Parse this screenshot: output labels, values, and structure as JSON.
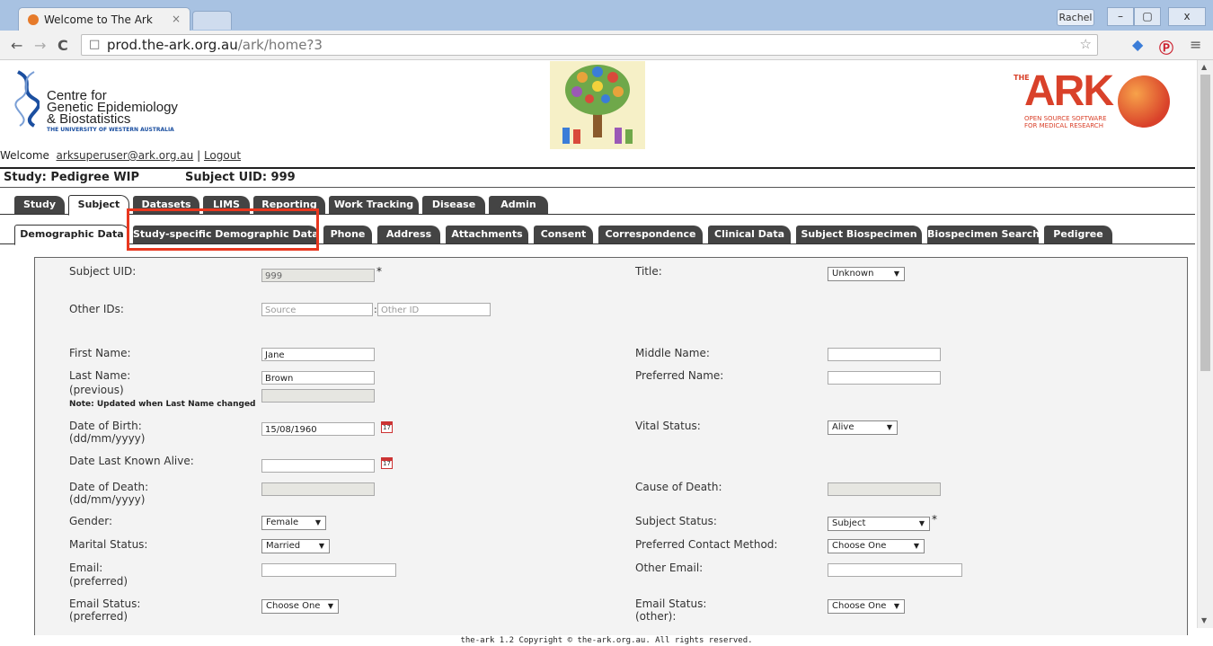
{
  "browser": {
    "tab_title": "Welcome to The Ark",
    "tab_close": "×",
    "user_badge": "Rachel",
    "win_min": "–",
    "win_max": "▢",
    "win_close": "x",
    "back": "←",
    "forward": "→",
    "reload": "C",
    "url_host": "prod.the-ark.org.au",
    "url_path": "/ark/home?3",
    "star": "☆",
    "menu": "≡"
  },
  "header": {
    "logo_line1": "Centre for",
    "logo_line2": "Genetic Epidemiology",
    "logo_line3": "& Biostatistics",
    "logo_sub": "THE UNIVERSITY OF WESTERN AUSTRALIA",
    "ark_the": "THE",
    "ark_word": "ARK",
    "ark_sub1": "OPEN SOURCE SOFTWARE",
    "ark_sub2": "FOR MEDICAL RESEARCH",
    "welcome": "Welcome",
    "user": "arksuperuser@ark.org.au",
    "separator": "|",
    "logout": "Logout"
  },
  "context": {
    "study": "Study: Pedigree WIP",
    "subject": "Subject UID: 999"
  },
  "top_tabs": [
    "Study",
    "Subject",
    "Datasets",
    "LIMS",
    "Reporting",
    "Work Tracking",
    "Disease",
    "Admin"
  ],
  "sub_tabs": [
    "Demographic Data",
    "Study-specific Demographic Data",
    "Phone",
    "Address",
    "Attachments",
    "Consent",
    "Correspondence",
    "Clinical Data",
    "Subject Biospecimen",
    "Biospecimen Search",
    "Pedigree"
  ],
  "form": {
    "subject_uid_label": "Subject UID:",
    "subject_uid_value": "999",
    "required_mark": "*",
    "title_label": "Title:",
    "title_value": "Unknown",
    "other_ids_label": "Other IDs:",
    "source_ph": "Source",
    "other_id_sep": ":",
    "other_id_ph": "Other ID",
    "first_name_label": "First Name:",
    "first_name_value": "Jane",
    "middle_name_label": "Middle Name:",
    "last_name_label": "Last Name:",
    "last_name_value": "Brown",
    "preferred_name_label": "Preferred Name:",
    "previous_label": "(previous)",
    "previous_note": "Note: Updated when Last Name changed",
    "dob_label": "Date of Birth:",
    "date_format": "(dd/mm/yyyy)",
    "dob_value": "15/08/1960",
    "vital_status_label": "Vital Status:",
    "vital_status_value": "Alive",
    "date_last_alive_label": "Date Last Known Alive:",
    "dod_label": "Date of Death:",
    "cause_of_death_label": "Cause of Death:",
    "gender_label": "Gender:",
    "gender_value": "Female",
    "subject_status_label": "Subject Status:",
    "subject_status_value": "Subject",
    "marital_status_label": "Marital Status:",
    "marital_status_value": "Married",
    "preferred_contact_label": "Preferred Contact Method:",
    "choose_one": "Choose One",
    "email_label": "Email:",
    "preferred_label": "(preferred)",
    "other_email_label": "Other Email:",
    "email_status_label": "Email Status:",
    "other_label": "(other):",
    "calendar_day": "17",
    "arrow": "▼"
  },
  "footer": "the-ark 1.2 Copyright © the-ark.org.au. All rights reserved.",
  "colors": {
    "highlight": "#e8371f",
    "tab_dark": "#444444",
    "ark_orange": "#d9412a"
  }
}
